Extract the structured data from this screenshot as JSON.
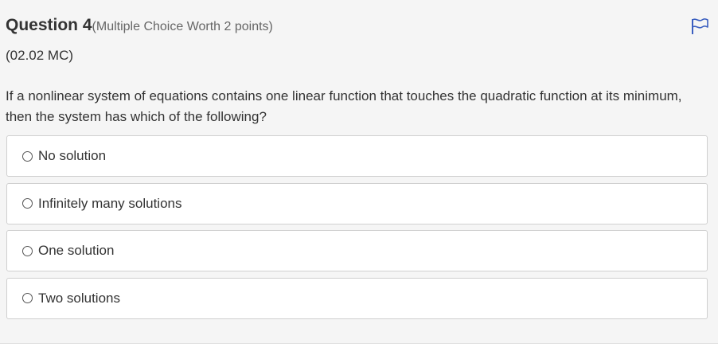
{
  "question": {
    "title": "Question 4",
    "worth": "(Multiple Choice Worth 2 points)",
    "code": "(02.02 MC)",
    "prompt": "If a nonlinear system of equations contains one linear function that touches the quadratic function at its minimum, then the system has which of the following?"
  },
  "flag": {
    "icon": "flag-icon",
    "color": "#3b5fc0"
  },
  "options": [
    {
      "label": "No solution"
    },
    {
      "label": "Infinitely many solutions"
    },
    {
      "label": "One solution"
    },
    {
      "label": "Two solutions"
    }
  ]
}
